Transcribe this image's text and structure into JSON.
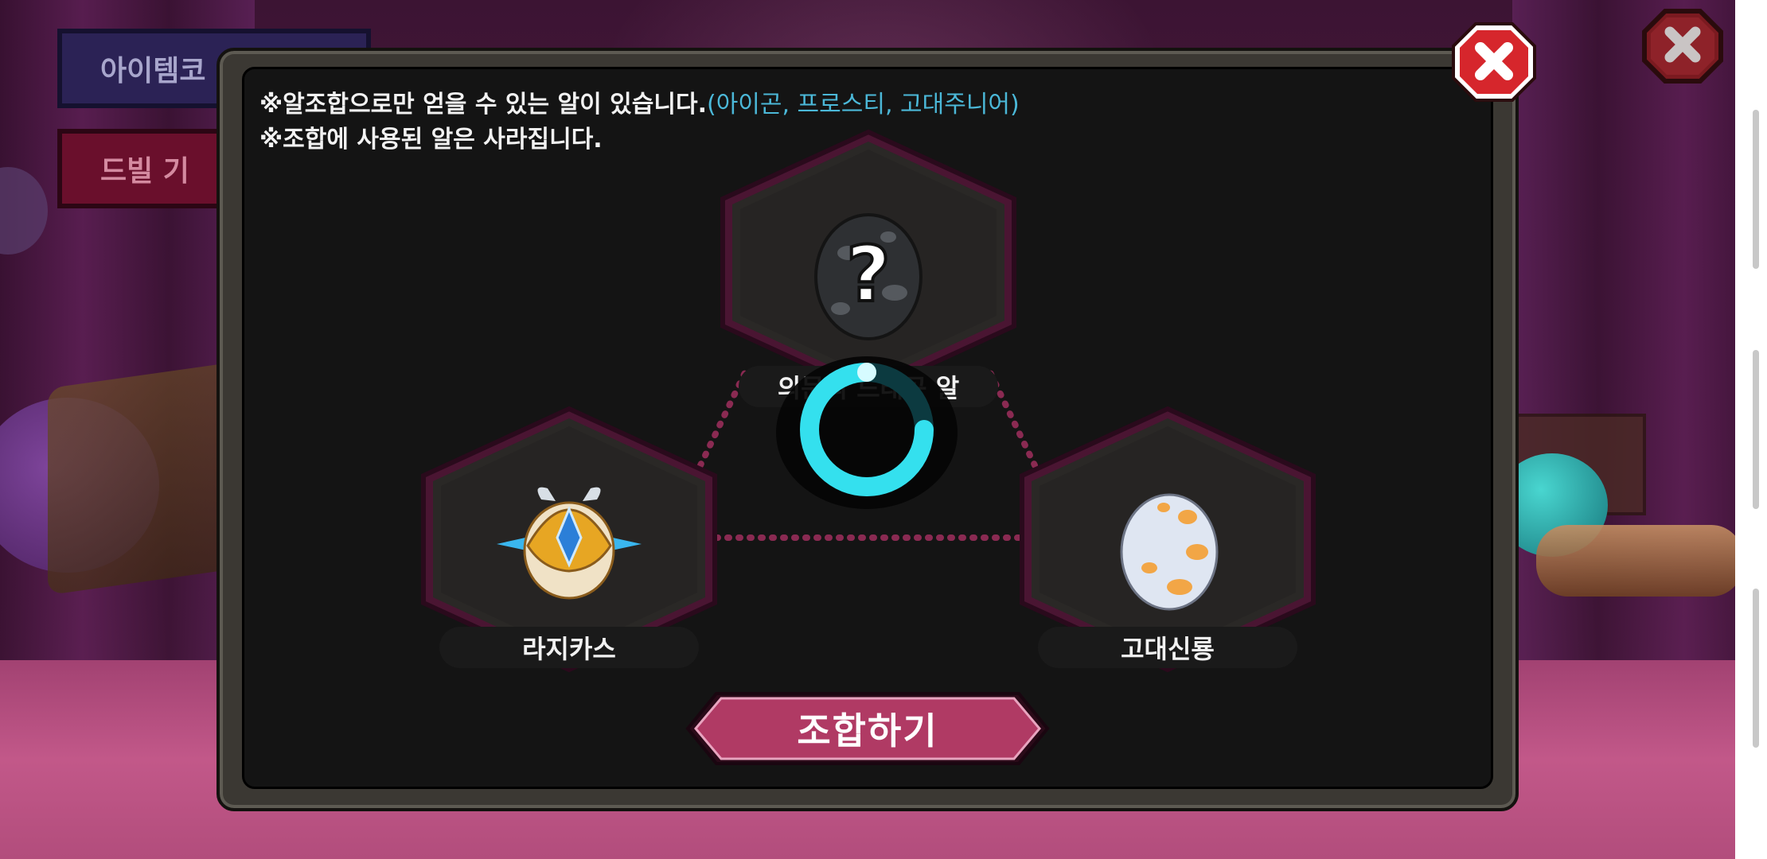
{
  "background": {
    "item_code_button": "아이템코",
    "devil_button": "드빌 기"
  },
  "dialog": {
    "notice_line1_prefix": "※알조합으로만 얻을 수 있는 알이 있습니다.",
    "notice_line1_highlight": "(아이곤, 프로스티, 고대주니어)",
    "notice_line2": "※조합에 사용된 알은 사라집니다.",
    "result_slot": {
      "label": "의문의 드래곤 알",
      "icon": "question-egg-icon"
    },
    "left_slot": {
      "label": "라지카스",
      "icon": "golden-armored-egg-icon"
    },
    "right_slot": {
      "label": "고대신룡",
      "icon": "spotted-white-egg-icon"
    },
    "combine_button": "조합하기"
  },
  "icons": {
    "close": "close-icon",
    "loading": "loading-spinner-icon"
  },
  "colors": {
    "highlight_text": "#4bb8d8",
    "hex_border": "#5a1a3c",
    "combine_button": "#b03a64",
    "close_red": "#d6262c",
    "spinner": "#34e0ee"
  }
}
